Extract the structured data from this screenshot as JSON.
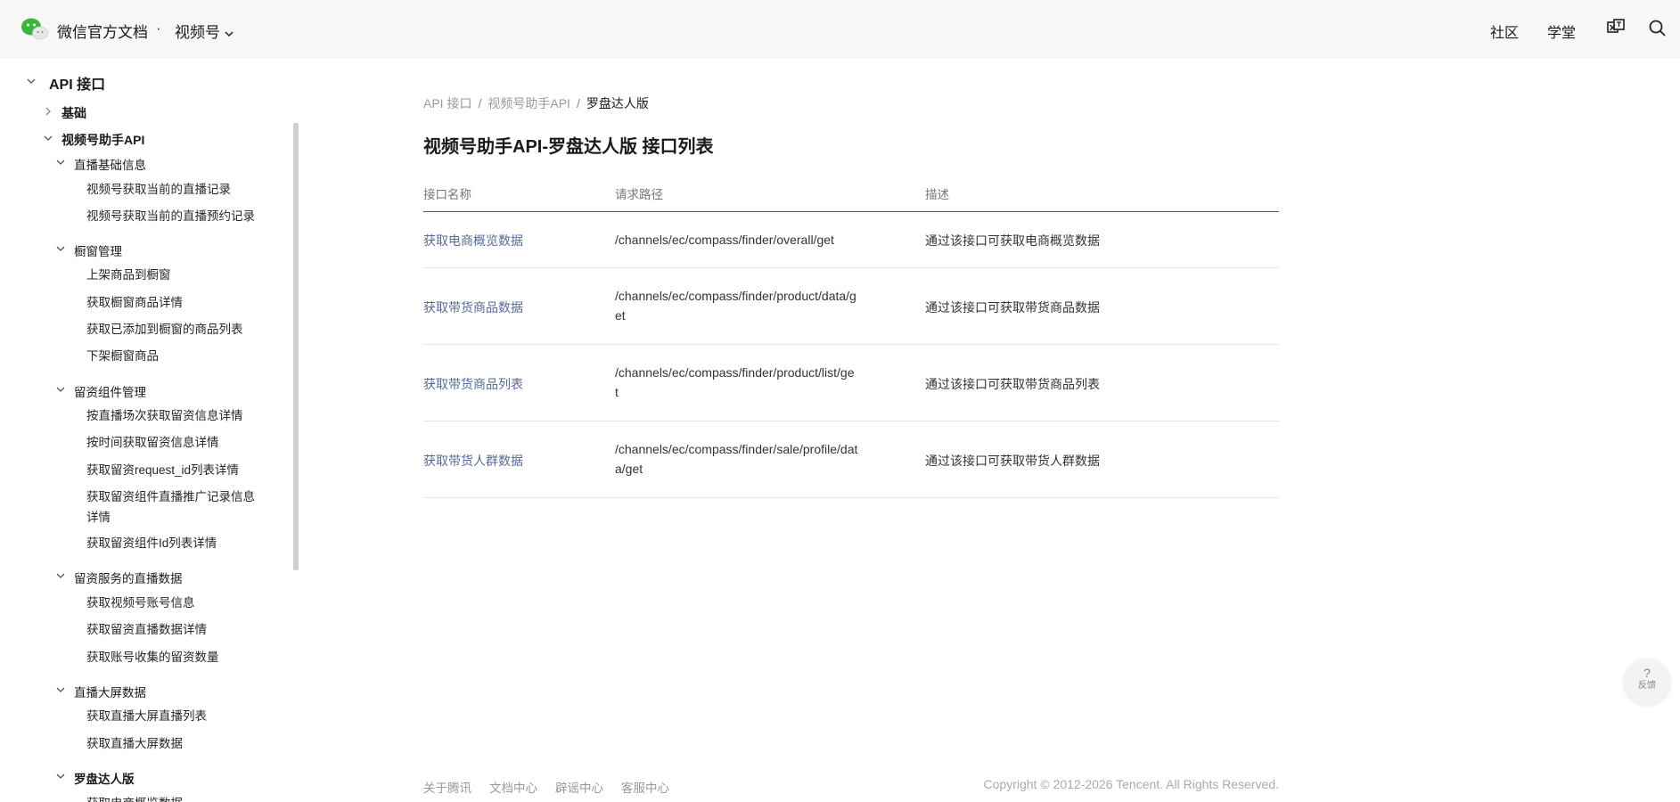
{
  "header": {
    "site_title": "微信官方文档",
    "separator": "·",
    "product": "视频号",
    "nav": [
      "社区",
      "学堂"
    ],
    "icons": [
      "translate-icon",
      "search-icon"
    ]
  },
  "sidebar": {
    "root": "API 接口",
    "basic": "基础",
    "assistant": "视频号助手API",
    "groups": {
      "live_basic": {
        "label": "直播基础信息",
        "items": [
          "视频号获取当前的直播记录",
          "视频号获取当前的直播预约记录"
        ]
      },
      "showcase": {
        "label": "橱窗管理",
        "items": [
          "上架商品到橱窗",
          "获取橱窗商品详情",
          "获取已添加到橱窗的商品列表",
          "下架橱窗商品"
        ]
      },
      "leads": {
        "label": "留资组件管理",
        "items": [
          "按直播场次获取留资信息详情",
          "按时间获取留资信息详情",
          "获取留资request_id列表详情",
          "获取留资组件直播推广记录信息",
          "详情",
          "获取留资组件Id列表详情"
        ]
      },
      "leads_live": {
        "label": "留资服务的直播数据",
        "items": [
          "获取视频号账号信息",
          "获取留资直播数据详情",
          "获取账号收集的留资数量"
        ]
      },
      "screen": {
        "label": "直播大屏数据",
        "items": [
          "获取直播大屏直播列表",
          "获取直播大屏数据"
        ]
      },
      "compass": {
        "label": "罗盘达人版",
        "items": [
          "获取电商概览数据"
        ]
      }
    }
  },
  "breadcrumb": [
    "API 接口",
    "/",
    "视频号助手API",
    "/",
    "罗盘达人版"
  ],
  "page_title": "视频号助手API-罗盘达人版 接口列表",
  "table": {
    "headers": [
      "接口名称",
      "请求路径",
      "描述"
    ],
    "rows": [
      {
        "name": "获取电商概览数据",
        "path": [
          "/channels/ec/compass/finder/overall/get"
        ],
        "desc": "通过该接口可获取电商概览数据"
      },
      {
        "name": "获取带货商品数据",
        "path": [
          "/channels/ec/compass/finder/product/data/g",
          "et"
        ],
        "desc": "通过该接口可获取带货商品数据"
      },
      {
        "name": "获取带货商品列表",
        "path": [
          "/channels/ec/compass/finder/product/list/ge",
          "t"
        ],
        "desc": "通过该接口可获取带货商品列表"
      },
      {
        "name": "获取带货人群数据",
        "path": [
          "/channels/ec/compass/finder/sale/profile/dat",
          "a/get"
        ],
        "desc": "通过该接口可获取带货人群数据"
      }
    ]
  },
  "footer": {
    "links": [
      "关于腾讯",
      "文档中心",
      "辟谣中心",
      "客服中心"
    ],
    "copyright": "Copyright © 2012-2026 Tencent. All Rights Reserved."
  },
  "feedback": {
    "glyph": "?",
    "label": "反馈"
  },
  "colors": {
    "link": "#576b95",
    "topbar_bg": "#f7f7f7",
    "wechat_green": "#3fb53d"
  }
}
